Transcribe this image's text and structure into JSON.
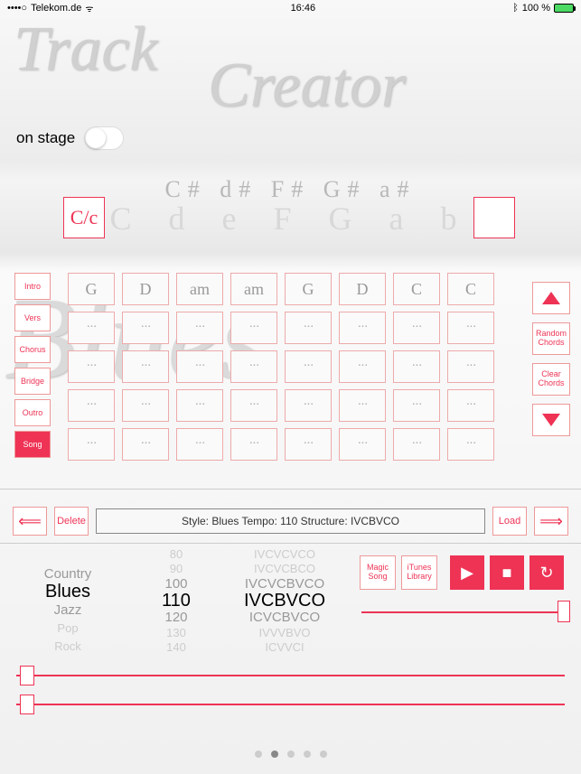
{
  "status": {
    "carrier": "Telekom.de",
    "time": "16:46",
    "battery": "100 %"
  },
  "watermarks": {
    "track": "Track",
    "creator": "Creator",
    "blues": "Blues"
  },
  "onstage": {
    "label": "on stage"
  },
  "key_selector": {
    "current": "C/c",
    "sharps": "C# d#   F# G# a#",
    "naturals": "C d e F G a b"
  },
  "sections": [
    "Intro",
    "Vers",
    "Chorus",
    "Bridge",
    "Outro",
    "Song"
  ],
  "active_section_index": 5,
  "chord_grid": [
    [
      "G",
      "D",
      "am",
      "am",
      "G",
      "D",
      "C",
      "C"
    ],
    [
      "···",
      "···",
      "···",
      "···",
      "···",
      "···",
      "···",
      "···"
    ],
    [
      "···",
      "···",
      "···",
      "···",
      "···",
      "···",
      "···",
      "···"
    ],
    [
      "···",
      "···",
      "···",
      "···",
      "···",
      "···",
      "···",
      "···"
    ],
    [
      "···",
      "···",
      "···",
      "···",
      "···",
      "···",
      "···",
      "···"
    ]
  ],
  "side_controls": {
    "up": "▲",
    "random": "Random Chords",
    "clear": "Clear Chords",
    "down": "▼"
  },
  "control_row": {
    "prev": "⟸",
    "delete": "Delete",
    "info": "Style: Blues   Tempo: 110   Structure: IVCBVCO",
    "load": "Load",
    "next": "⟹"
  },
  "pickers": {
    "style": [
      "",
      "Country",
      "Blues",
      "Jazz",
      "Pop",
      "Rock"
    ],
    "tempo": [
      "80",
      "90",
      "100",
      "110",
      "120",
      "130",
      "140"
    ],
    "structure": [
      "IVCVCVCO",
      "IVCVCBCO",
      "IVCVCBVCO",
      "IVCBVCO",
      "ICVCBVCO",
      "IVVVBVO",
      "ICVVCI"
    ]
  },
  "actions": {
    "magic": "Magic Song",
    "itunes": "iTunes Library"
  },
  "transport": {
    "play": "▶",
    "stop": "■",
    "loop": "↻"
  }
}
